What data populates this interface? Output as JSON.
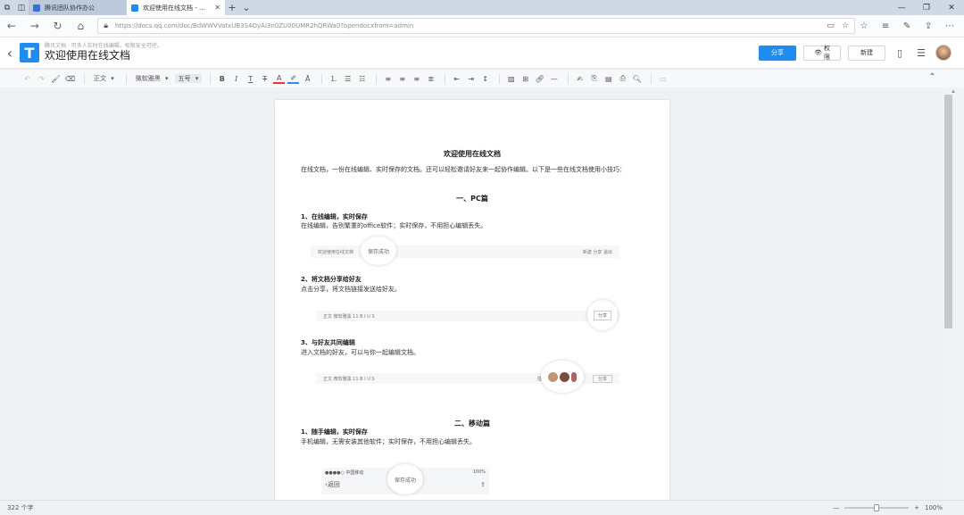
{
  "browser": {
    "tabs": [
      {
        "title": "腾讯团队协作办公",
        "active": false,
        "favicon_color": "#3d6fd6"
      },
      {
        "title": "欢迎使用在线文档 - 腾讯",
        "active": true,
        "favicon_color": "#1f8cf0"
      }
    ],
    "url": "https://docs.qq.com/doc/BdWWVVatxUB3S4OyAi3n0ZU00UMR2hQRWa0?opendocxfrom=admin"
  },
  "doc_header": {
    "subtitle": "腾讯文档 · 可多人实时在线编辑，权限安全可控。",
    "title": "欢迎使用在线文档",
    "share_label": "分享",
    "permission_label": "权限",
    "new_label": "新建"
  },
  "toolbar": {
    "style_label": "正文",
    "font_label": "微软雅黑",
    "size_label": "五号"
  },
  "document": {
    "title": "欢迎使用在线文档",
    "intro": "在线文档，一份在线编辑、实时保存的文档。还可以轻松邀请好友来一起协作编辑。以下是一些在线文档使用小技巧：",
    "section_pc": "一、PC篇",
    "item1_title": "1、在线编辑，实时保存",
    "item1_body": "在线编辑，告别繁重的office软件；实时保存，不用担心编辑丢失。",
    "demo1_doc_title": "欢迎使用在线文档",
    "demo1_bubble": "保存成功",
    "demo1_right": "新建 分享 退出",
    "item2_title": "2、将文档分享给好友",
    "item2_body": "点击分享，将文档链接发送给好友。",
    "demo2_bubble": "分享",
    "demo_toolbar_text": "正文    微软雅黑    11    B  I  U  S",
    "demo3_insert": "插入",
    "item3_title": "3、与好友共同编辑",
    "item3_body": "进入文档的好友，可以与你一起编辑文档。",
    "demo3_share": "分享",
    "section_mobile": "二、移动篇",
    "m1_title": "1、随手编辑，实时保存",
    "m1_body": "手机编辑，无需安装其他软件；实时保存，不用担心编辑丢失。",
    "phone_carrier": "●●●●○ 中国移动",
    "phone_battery": "100%",
    "phone_back": "返回",
    "phone_bubble": "保存成功"
  },
  "status": {
    "word_count": "322 个字",
    "zoom": "100%",
    "zoom_fraction": 0.5
  }
}
